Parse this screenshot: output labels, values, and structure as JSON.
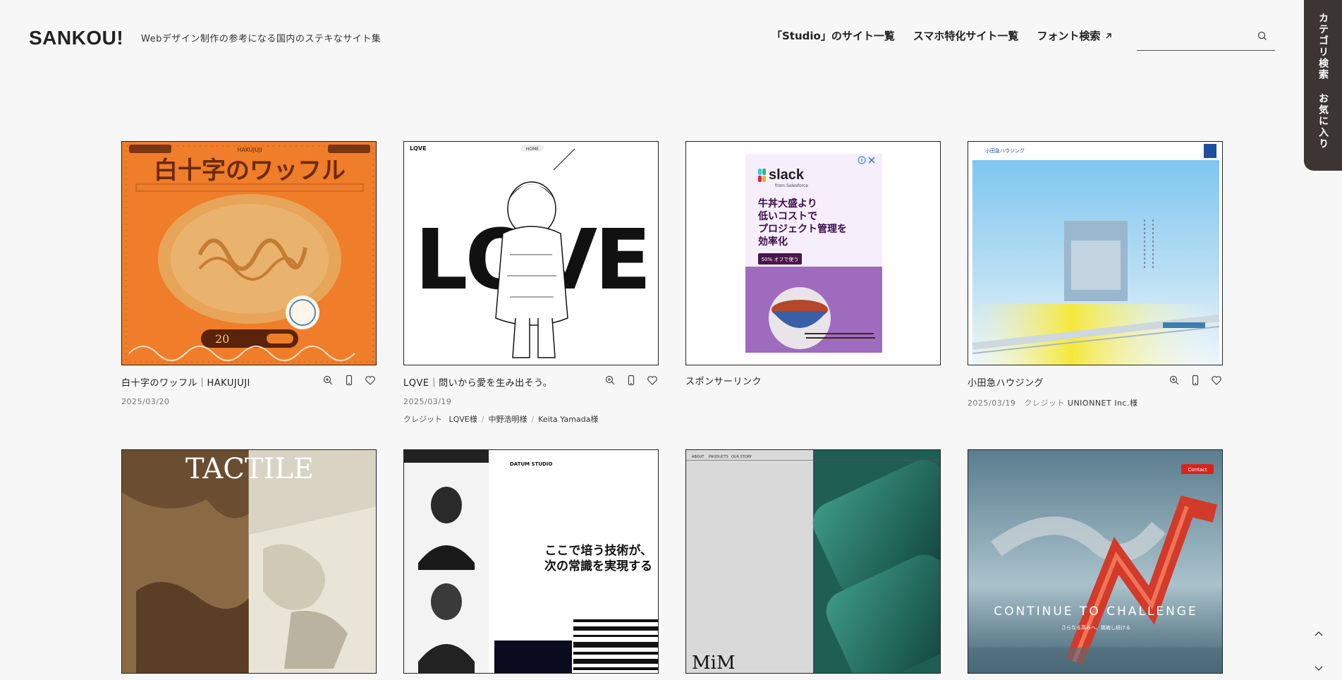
{
  "header": {
    "logo": "SANKOU!",
    "tagline": "Webデザイン制作の参考になる国内のステキなサイト集",
    "nav": [
      {
        "label": "「Studio」のサイト一覧"
      },
      {
        "label": "スマホ特化サイト一覧"
      },
      {
        "label": "フォント検索",
        "icon": "external-arrow-icon"
      }
    ],
    "search": {
      "placeholder": "",
      "icon": "search-icon"
    }
  },
  "sidetab": {
    "category_label": "カテゴリ検索",
    "favorites_label": "お気に入り"
  },
  "cards_row1": [
    {
      "title": "白十字のワッフル｜HAKUJUJI",
      "date": "2025/03/20",
      "thumb_text": "白十字のワッフル",
      "thumb_brand": "HAKUJUJI",
      "thumb_price": "20"
    },
    {
      "title": "LQVE｜問いから愛を生み出そう。",
      "date": "2025/03/19",
      "credit_label": "クレジット",
      "credits": [
        "LQVE様",
        "中野浩明様",
        "Keita Yamada様"
      ],
      "thumb_text": "LQVE",
      "thumb_logo": "LQVE",
      "thumb_nav": "HOME"
    },
    {
      "title": "スポンサーリンク",
      "ad_brand": "slack",
      "ad_from": "from Salesforce",
      "ad_copy": [
        "牛丼大盛より",
        "低いコストで",
        "プロジェクト管理を",
        "効率化"
      ],
      "ad_button": "50% オフで使う"
    },
    {
      "title": "小田急ハウジング",
      "date": "2025/03/19",
      "credit_label": "クレジット",
      "credit_name": "UNIONNET Inc.様",
      "thumb_logo": "小田急ハウジング"
    }
  ],
  "cards_row2": [
    {
      "thumb_text": "TACTILE"
    },
    {
      "thumb_text_1": "ここで培う技術が、",
      "thumb_text_2": "次の常識を実現する",
      "thumb_logo": "DATUM STUDIO"
    },
    {
      "thumb_text": "MiM",
      "thumb_nav": [
        "ABOUT",
        "PRODUCTS",
        "OUR STORY"
      ]
    },
    {
      "thumb_text": "CONTINUE TO CHALLENGE",
      "thumb_sub": "さらなる高みへ、挑戦し続ける",
      "thumb_button": "Contact"
    }
  ],
  "colors": {
    "sidetab": "#3d3533",
    "accent_orange": "#f07d2a",
    "waffle": "#e7a55a"
  }
}
